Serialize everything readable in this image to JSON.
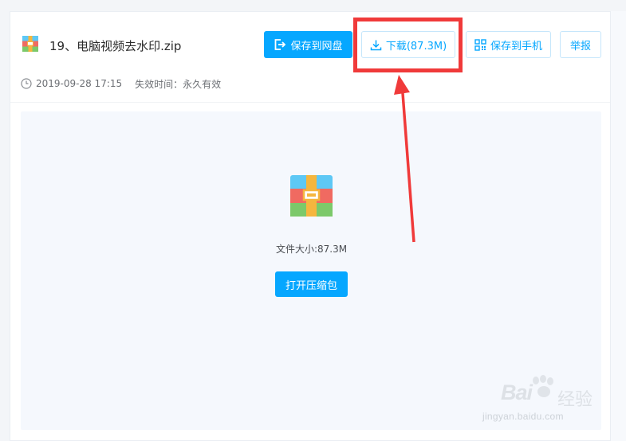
{
  "file": {
    "name": "19、电脑视频去水印.zip",
    "date": "2019-09-28 17:15",
    "expire_label": "失效时间：永久有效"
  },
  "toolbar": {
    "save_to_cloud": "保存到网盘",
    "download": "下载(87.3M)",
    "save_to_phone": "保存到手机",
    "report": "举报"
  },
  "preview": {
    "size_label": "文件大小:87.3M",
    "open_archive": "打开压缩包"
  },
  "watermark": {
    "brand": "Bai",
    "brand_cn": "经验",
    "url": "jingyan.baidu.com"
  },
  "colors": {
    "accent": "#06a7ff",
    "highlight": "#f03a3a",
    "archive_top": "#5ec8f5",
    "archive_mid": "#f06a61",
    "archive_bottom": "#7cc96a",
    "archive_strap": "#f5b63e"
  },
  "icons": {
    "file_small": "archive-icon",
    "clock": "clock-icon",
    "save_cloud": "save-to-cloud-icon",
    "download": "download-icon",
    "qr": "qr-code-icon",
    "archive_large": "archive-icon"
  }
}
